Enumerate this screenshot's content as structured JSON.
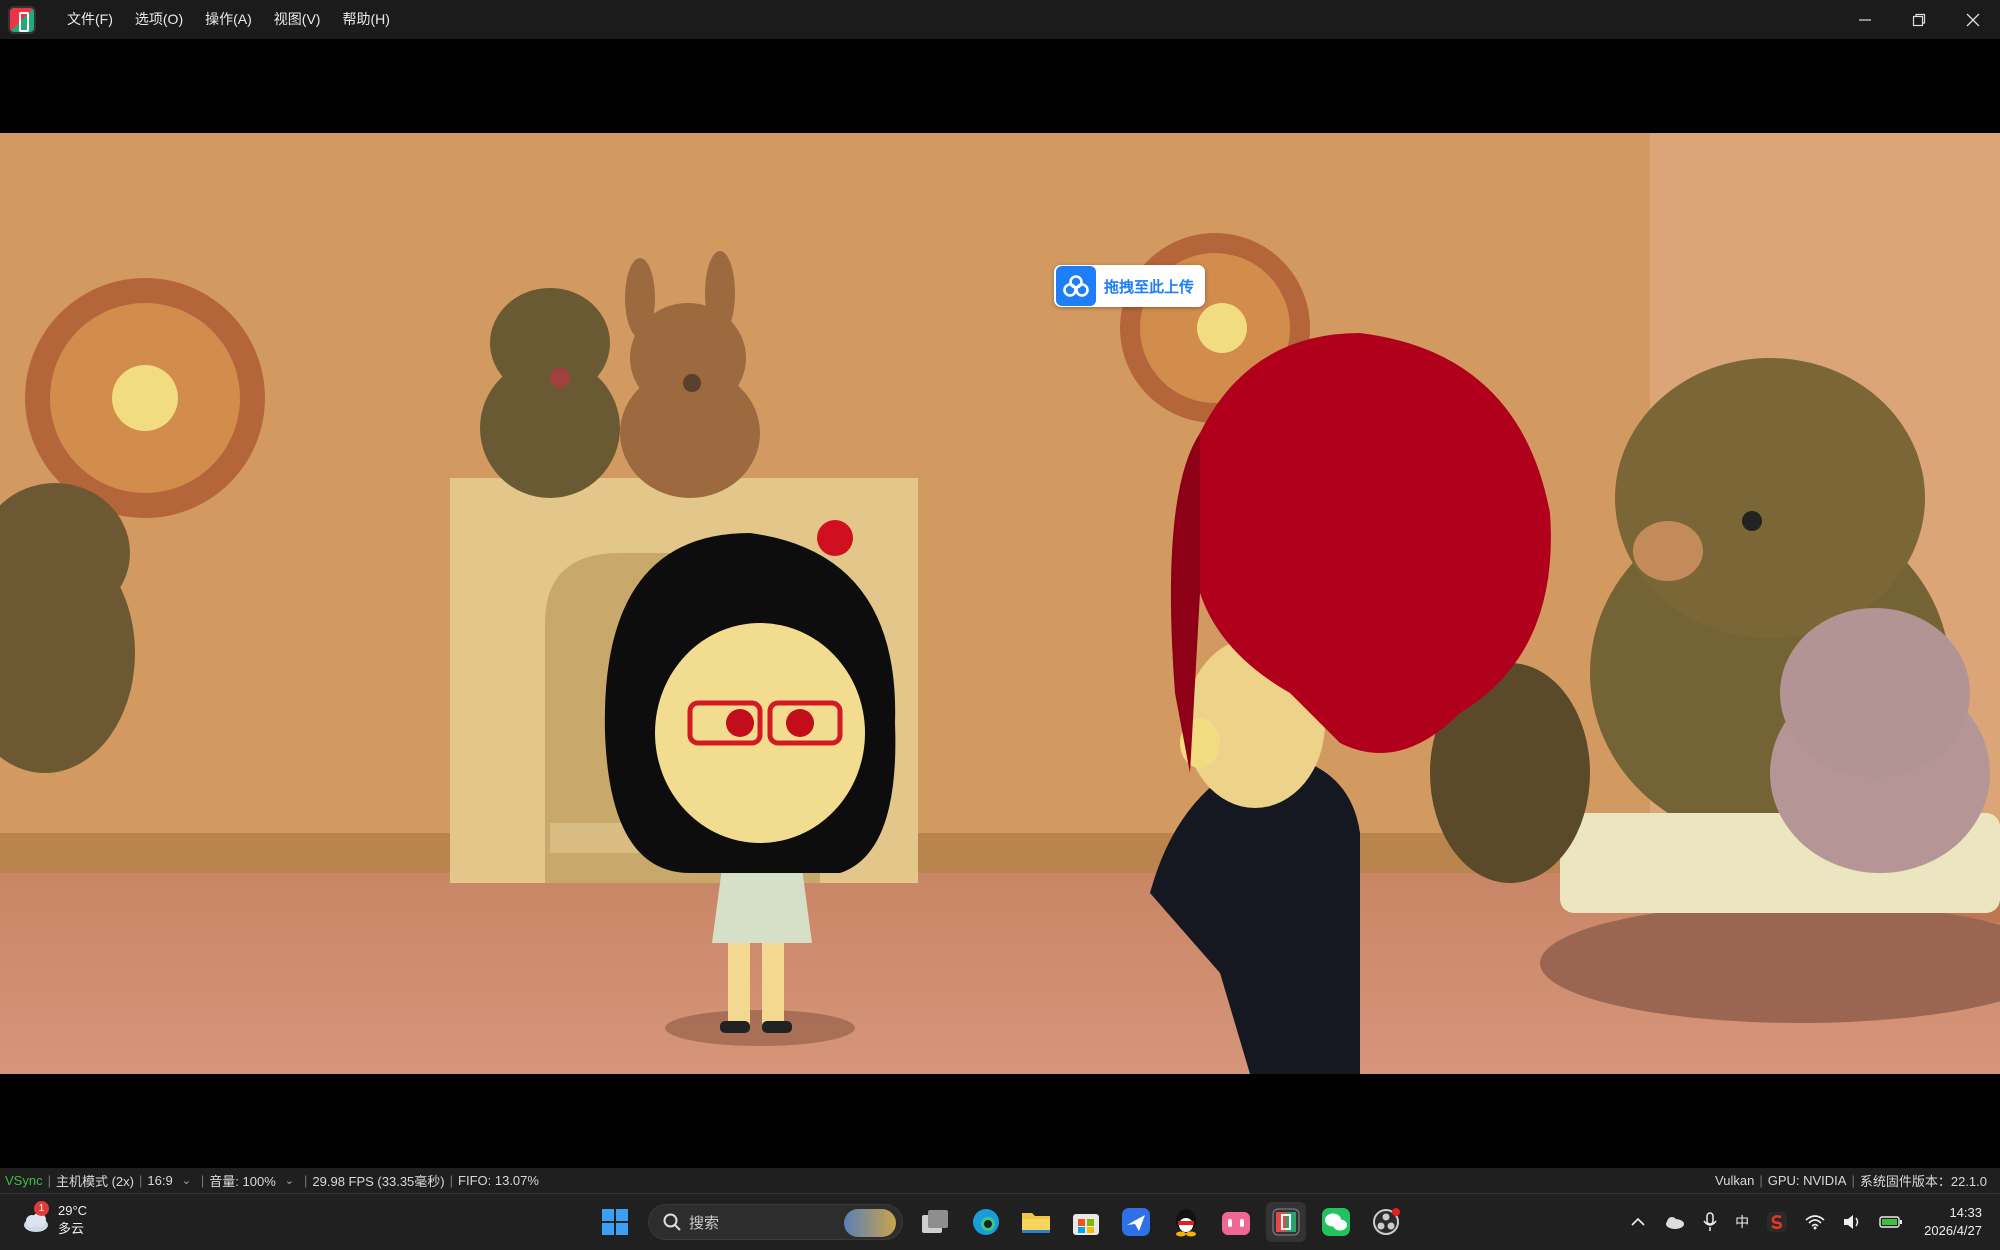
{
  "window": {
    "menu": [
      "文件(F)",
      "选项(O)",
      "操作(A)",
      "视图(V)",
      "帮助(H)"
    ],
    "controls": [
      "minimize-icon",
      "restore-icon",
      "close-icon"
    ]
  },
  "overlay": {
    "upload_label": "拖拽至此上传",
    "upload_icon": "cloud-drive-icon"
  },
  "status": {
    "vsync": "VSync",
    "host_mode": "主机模式 (2x)",
    "aspect": "16:9",
    "volume": "音量: 100%",
    "fps": "29.98 FPS (33.35毫秒)",
    "fifo": "FIFO: 13.07%",
    "api": "Vulkan",
    "gpu": "GPU: NVIDIA",
    "firmware": "系统固件版本：22.1.0"
  },
  "taskbar": {
    "weather_badge": "1",
    "temperature": "29°C",
    "condition": "多云",
    "search_placeholder": "搜索",
    "apps": [
      "windows-start-icon",
      "task-view-icon",
      "edge-icon",
      "file-explorer-icon",
      "store-icon",
      "feishu-icon",
      "qq-icon",
      "bilibili-icon",
      "emulator-icon",
      "wechat-icon",
      "obs-icon"
    ],
    "ime": "中",
    "time": "14:33",
    "date": "2026/4/27"
  },
  "colors": {
    "titlebar": "#1b1b1b",
    "statusbar": "#1f1f1f",
    "taskbar": "#202020",
    "vsync_green": "#3fbf3f",
    "upload_blue": "#1e7ef7",
    "hair_red": "#b0001b"
  }
}
